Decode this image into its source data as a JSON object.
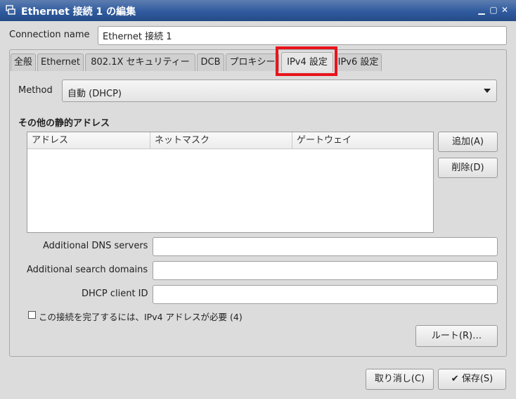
{
  "window": {
    "title": "Ethernet 接続 1 の編集",
    "controls": [
      "minimize-icon",
      "maximize-icon",
      "close-icon"
    ]
  },
  "connection_name": {
    "label": "Connection name",
    "value": "Ethernet 接続 1"
  },
  "tabs": [
    {
      "label": "全般"
    },
    {
      "label": "Ethernet"
    },
    {
      "label": "802.1X セキュリティー"
    },
    {
      "label": "DCB"
    },
    {
      "label": "プロキシー"
    },
    {
      "label": "IPv4 設定",
      "active": true
    },
    {
      "label": "IPv6 設定"
    }
  ],
  "ipv4": {
    "method_label": "Method",
    "method_value": "自動 (DHCP)",
    "section_title": "その他の静的アドレス",
    "columns": [
      "アドレス",
      "ネットマスク",
      "ゲートウェイ"
    ],
    "add_label": "追加(A)",
    "delete_label": "削除(D)",
    "dns_label": "Additional DNS servers",
    "dns_value": "",
    "search_label": "Additional search domains",
    "search_value": "",
    "dhcp_id_label": "DHCP client ID",
    "dhcp_id_value": "",
    "require_label": "この接続を完了するには、IPv4 アドレスが必要 (4)",
    "require_checked": false,
    "routes_label": "ルート(R)…"
  },
  "footer": {
    "cancel_label": "取り消し(C)",
    "save_label": "保存(S)"
  },
  "colors": {
    "titlebar": "#2f5b9f",
    "highlight": "#e8141b",
    "dialog_bg": "#dcdcdc"
  }
}
